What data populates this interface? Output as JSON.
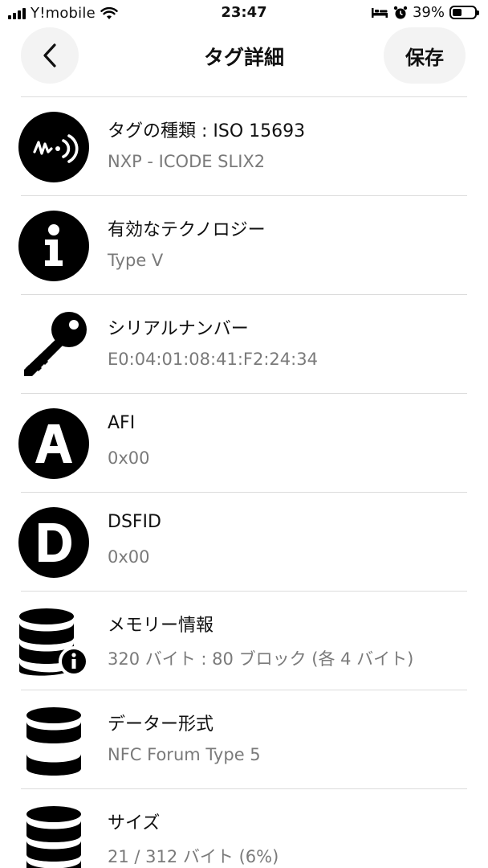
{
  "status_bar": {
    "carrier": "Y!mobile",
    "time": "23:47",
    "battery_percent": "39%"
  },
  "header": {
    "title": "タグ詳細",
    "save_label": "保存"
  },
  "rows": [
    {
      "icon": "nfc-signal-icon",
      "title": "タグの種類 : ISO 15693",
      "value": "NXP - ICODE SLIX2"
    },
    {
      "icon": "info-icon",
      "title": "有効なテクノロジー",
      "value": "Type V"
    },
    {
      "icon": "key-icon",
      "title": "シリアルナンバー",
      "value": "E0:04:01:08:41:F2:24:34"
    },
    {
      "icon": "letter-a-icon",
      "title": "AFI",
      "value": "0x00"
    },
    {
      "icon": "letter-d-icon",
      "title": "DSFID",
      "value": "0x00"
    },
    {
      "icon": "database-info-icon",
      "title": "メモリー情報",
      "value": "320 バイト : 80 ブロック (各 4 バイト)"
    },
    {
      "icon": "database-format-icon",
      "title": "データー形式",
      "value": "NFC Forum Type 5"
    },
    {
      "icon": "database-icon",
      "title": "サイズ",
      "value": "21 / 312 バイト (6%)"
    }
  ]
}
